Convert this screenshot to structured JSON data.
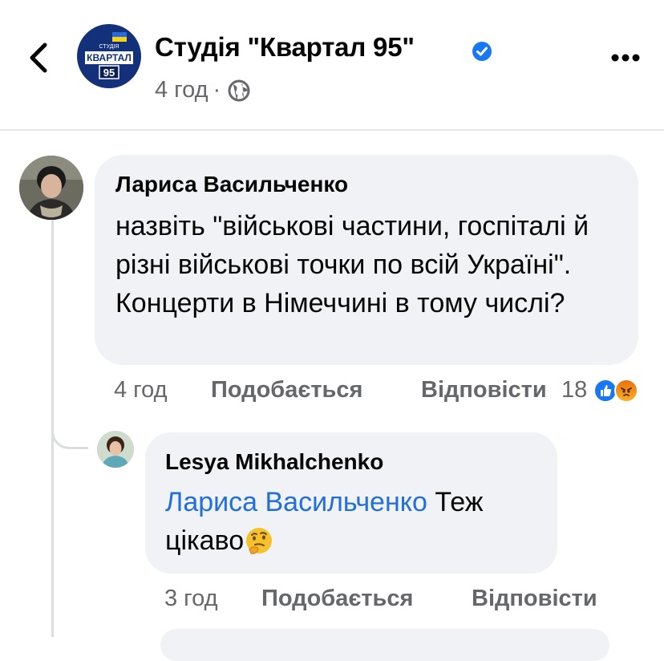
{
  "header": {
    "page_name": "Студія \"Квартал 95\"",
    "post_time": "4 год",
    "separator": "·",
    "logo_text_top": "СТУДІЯ",
    "logo_text_main": "КВАРТАЛ",
    "logo_text_num": "95",
    "icons": [
      "back-chevron-icon",
      "verified-badge-icon",
      "globe-icon",
      "more-options-icon"
    ]
  },
  "comments": [
    {
      "author": "Лариса Васильченко",
      "text": "назвіть \"військові частини, госпіталі й різні військові точки по всій Україні\". Концерти в Німеччині в тому числі?",
      "time": "4 год",
      "like_label": "Подобається",
      "reply_label": "Відповісти",
      "reaction_count": "18",
      "reactions": [
        "like",
        "angry"
      ]
    },
    {
      "author": "Lesya Mikhalchenko",
      "mention": "Лариса Васильченко",
      "text": " Теж цікаво",
      "emoji": "thinking-face",
      "time": "3 год",
      "like_label": "Подобається",
      "reply_label": "Відповісти"
    }
  ],
  "colors": {
    "text_primary": "#050505",
    "text_secondary": "#65676b",
    "bubble_bg": "#f0f2f5",
    "mention": "#216fdb",
    "verified": "#1877f2",
    "logo_bg": "#13317a"
  }
}
